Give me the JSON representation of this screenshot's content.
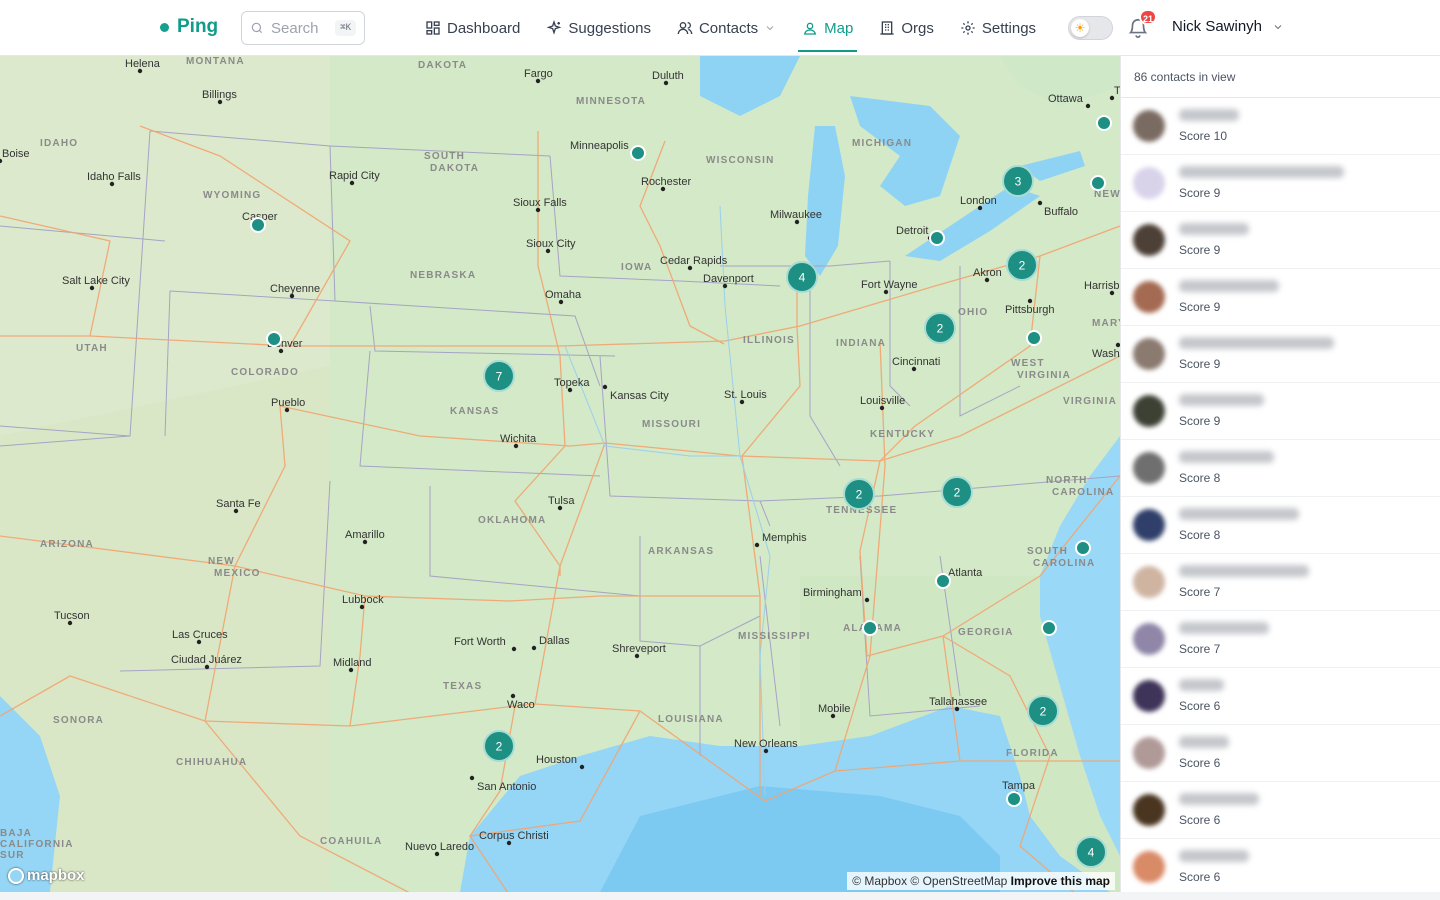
{
  "brand": {
    "name": "Ping"
  },
  "search": {
    "placeholder": "Search",
    "shortcut": "⌘K"
  },
  "nav": [
    {
      "label": "Dashboard",
      "icon": "dashboard-icon",
      "active": false
    },
    {
      "label": "Suggestions",
      "icon": "sparkles-icon",
      "active": false
    },
    {
      "label": "Contacts",
      "icon": "users-icon",
      "active": false
    },
    {
      "label": "Map",
      "icon": "map-pin-icon",
      "active": true
    },
    {
      "label": "Orgs",
      "icon": "building-icon",
      "active": false
    },
    {
      "label": "Settings",
      "icon": "gear-icon",
      "active": false
    }
  ],
  "notifications": {
    "count": "21"
  },
  "user": {
    "name": "Nick Sawinyh"
  },
  "map": {
    "attribution": "© Mapbox © OpenStreetMap",
    "improve": "Improve this map",
    "logo": "mapbox",
    "markers": [
      {
        "label": "7"
      },
      {
        "label": "4"
      },
      {
        "label": "3"
      },
      {
        "label": "2"
      },
      {
        "label": "2"
      },
      {
        "label": "2"
      },
      {
        "label": "2"
      },
      {
        "label": "2"
      },
      {
        "label": "2"
      },
      {
        "label": "4"
      }
    ],
    "cities": [
      "Helena",
      "Billings",
      "Fargo",
      "Duluth",
      "Ottawa",
      "Boise",
      "Idaho Falls",
      "Minneapolis",
      "Rapid City",
      "Rochester",
      "Casper",
      "Sioux Falls",
      "Milwaukee",
      "Toronto",
      "London",
      "Buffalo",
      "Sioux City",
      "Detroit",
      "Cedar Rapids",
      "Salt Lake City",
      "Cheyenne",
      "Davenport",
      "Fort Wayne",
      "Akron",
      "Pittsburgh",
      "Omaha",
      "Denver",
      "Cincinnati",
      "Topeka",
      "Kansas City",
      "St. Louis",
      "Pueblo",
      "Louisville",
      "Wichita",
      "Santa Fe",
      "Tulsa",
      "Amarillo",
      "Memphis",
      "Atlanta",
      "Birmingham",
      "Lubbock",
      "Tucson",
      "Las Cruces",
      "Ciudad Juárez",
      "Fort Worth",
      "Dallas",
      "Shreveport",
      "Midland",
      "Waco",
      "Mobile",
      "Tallahassee",
      "New Orleans",
      "Houston",
      "San Antonio",
      "Tampa",
      "Corpus Christi",
      "Nuevo Laredo",
      "Harrisb",
      "Washi"
    ],
    "states": [
      "MONTANA",
      "DAKOTA",
      "MINNESOTA",
      "IDAHO",
      "SOUTH DAKOTA",
      "WISCONSIN",
      "MICHIGAN",
      "WYOMING",
      "NEBRASKA",
      "IOWA",
      "OHIO",
      "ILLINOIS",
      "INDIANA",
      "UTAH",
      "COLORADO",
      "KANSAS",
      "MISSOURI",
      "KENTUCKY",
      "WEST VIRGINIA",
      "VIRGINIA",
      "ARIZONA",
      "NEW MEXICO",
      "OKLAHOMA",
      "ARKANSAS",
      "TENNESSEE",
      "NORTH CAROLINA",
      "SOUTH CAROLINA",
      "GEORGIA",
      "ALABAMA",
      "MISSISSIPPI",
      "TEXAS",
      "LOUISIANA",
      "FLORIDA",
      "SONORA",
      "CHIHUAHUA",
      "COAHUILA",
      "BAJA CALIFORNIA SUR",
      "NEW",
      "MARY"
    ]
  },
  "panel": {
    "count_text": "86 contacts in view",
    "contacts": [
      {
        "score": "Score 10",
        "avatar_color": "#7a6b62"
      },
      {
        "score": "Score 9",
        "avatar_color": "#d9d3ea"
      },
      {
        "score": "Score 9",
        "avatar_color": "#4d4036"
      },
      {
        "score": "Score 9",
        "avatar_color": "#a46a52"
      },
      {
        "score": "Score 9",
        "avatar_color": "#8a7a70"
      },
      {
        "score": "Score 9",
        "avatar_color": "#3c4134"
      },
      {
        "score": "Score 8",
        "avatar_color": "#6f6f70"
      },
      {
        "score": "Score 8",
        "avatar_color": "#2f3f6a"
      },
      {
        "score": "Score 7",
        "avatar_color": "#cfb4a2"
      },
      {
        "score": "Score 7",
        "avatar_color": "#8f86a8"
      },
      {
        "score": "Score 6",
        "avatar_color": "#3e3358"
      },
      {
        "score": "Score 6",
        "avatar_color": "#b09a98"
      },
      {
        "score": "Score 6",
        "avatar_color": "#4a3620"
      },
      {
        "score": "Score 6",
        "avatar_color": "#d98a66"
      }
    ]
  }
}
